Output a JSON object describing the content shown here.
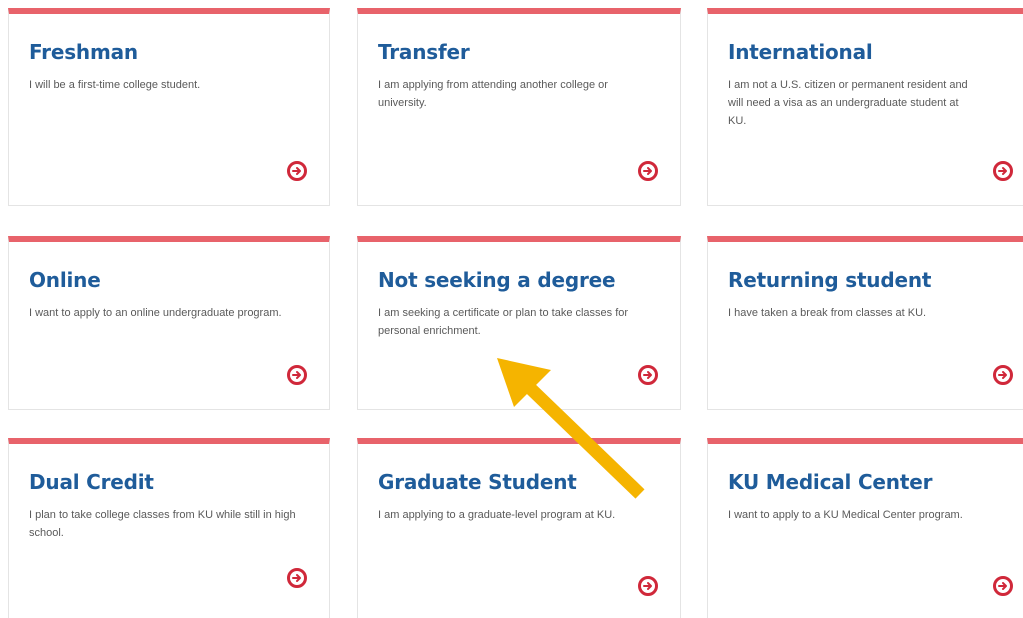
{
  "cards": [
    {
      "title": "Freshman",
      "description": "I will be a first-time college student."
    },
    {
      "title": "Transfer",
      "description": "I am applying from attending another college or university."
    },
    {
      "title": "International",
      "description": "I am not a U.S. citizen or permanent resident and will need a visa as an undergraduate student at KU."
    },
    {
      "title": "Online",
      "description": "I want to apply to an online undergraduate program."
    },
    {
      "title": "Not seeking a degree",
      "description": "I am seeking a certificate or plan to take classes for personal enrichment."
    },
    {
      "title": "Returning student",
      "description": "I have taken a break from classes at KU."
    },
    {
      "title": "Dual Credit",
      "description": "I plan to take college classes from KU while still in high school."
    },
    {
      "title": "Graduate Student",
      "description": "I am applying to a graduate-level program at KU."
    },
    {
      "title": "KU Medical Center",
      "description": "I want to apply to a KU Medical Center program."
    }
  ],
  "colors": {
    "accent_bar": "#e8636b",
    "title_blue": "#1f5c9a",
    "arrow_red": "#d0283a",
    "pointer_arrow": "#f5b400"
  },
  "icons": {
    "card_link": "circled-arrow-right-icon",
    "annotation": "pointer-arrow-icon"
  }
}
